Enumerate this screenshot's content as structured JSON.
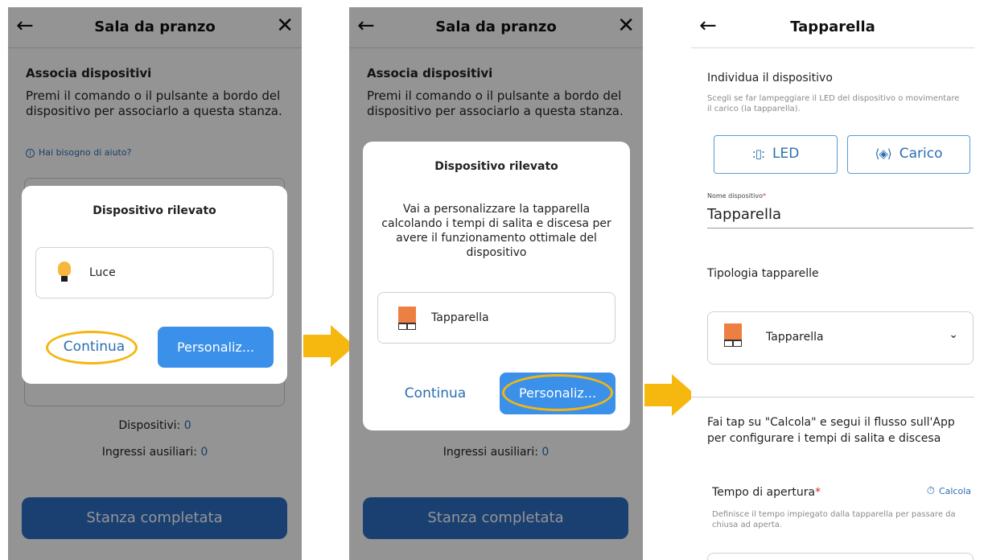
{
  "screen1": {
    "header": {
      "back_icon": "←",
      "title": "Sala da pranzo",
      "close_icon": "✕"
    },
    "section_title": "Associa dispositivi",
    "section_desc": "Premi il comando o il pulsante a bordo del dispositivo per associarlo a questa stanza.",
    "help_link": "Hai bisogno di aiuto?",
    "devices_label": "Dispositivi:",
    "devices_count": "0",
    "aux_label": "Ingressi ausiliari:",
    "aux_count": "0",
    "complete_button": "Stanza completata",
    "modal": {
      "title": "Dispositivo rilevato",
      "device_name": "Luce",
      "continue_label": "Continua",
      "customize_label": "Personaliz..."
    }
  },
  "screen2": {
    "header": {
      "back_icon": "←",
      "title": "Sala da pranzo",
      "close_icon": "✕"
    },
    "section_title": "Associa dispositivi",
    "section_desc": "Premi il comando o il pulsante a bordo del dispositivo per associarlo a questa stanza.",
    "aux_label": "Ingressi ausiliari:",
    "aux_count": "0",
    "complete_button": "Stanza completata",
    "modal": {
      "title": "Dispositivo rilevato",
      "body": "Vai a personalizzare la tapparella calcolando i tempi di salita e discesa per avere il funzionamento ottimale del dispositivo",
      "device_name": "Tapparella",
      "continue_label": "Continua",
      "customize_label": "Personaliz..."
    }
  },
  "screen3": {
    "header": {
      "back_icon": "←",
      "title": "Tapparella"
    },
    "identify_title": "Individua il dispositivo",
    "identify_desc": "Scegli se far lampeggiare il LED del dispositivo o movimentare il carico (la tapparella).",
    "led_button": "LED",
    "load_button": "Carico",
    "name_field_label": "Nome dispositivo",
    "required_mark": "*",
    "name_field_value": "Tapparella",
    "type_title": "Tipologia tapparelle",
    "type_value": "Tapparella",
    "instructions": "Fai tap su \"Calcola\" e segui il flusso sull'App per configurare i tempi di salita e discesa",
    "open_time_label": "Tempo di apertura",
    "calc_link": "Calcola",
    "open_time_desc": "Definisce il tempo impiegato dalla tapparella per passare da chiusa ad aperta."
  },
  "colors": {
    "accent": "#2a6fb3",
    "primary_button": "#3b91ea",
    "highlight_ring": "#f4b60f",
    "flow_arrow": "#f6b80f",
    "blind_orange": "#ee7f43",
    "bulb_yellow": "#f6b73c"
  }
}
